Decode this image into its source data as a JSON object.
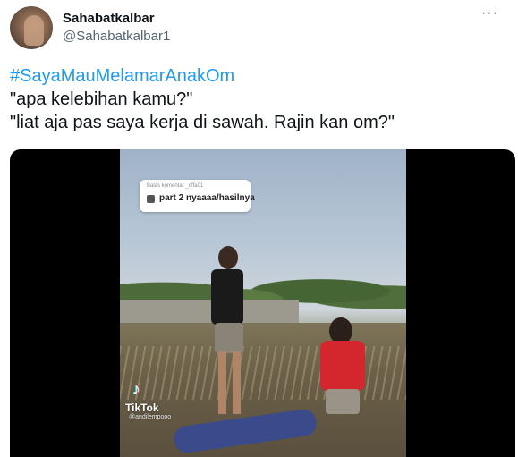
{
  "author": {
    "display_name": "Sahabatkalbar",
    "handle": "@Sahabatkalbar1",
    "avatar_icon": "profile-photo"
  },
  "menu": {
    "more_label": "···",
    "icon": "more-icon"
  },
  "tweet": {
    "hashtag": "#SayaMauMelamarAnakOm",
    "line1": "\"apa kelebihan kamu?\"",
    "line2": "\"liat aja pas saya kerja di sawah. Rajin kan om?\""
  },
  "video": {
    "comment_reply_to": "Balas komentar _dffa01",
    "comment_text": "part 2 nyaaaa/hasilnya",
    "watermark_brand": "TikTok",
    "watermark_user": "@andilempooo"
  },
  "colors": {
    "link": "#1d9bf0",
    "text": "#0f1419",
    "secondary": "#536471",
    "shirt_red": "#d3262d"
  }
}
